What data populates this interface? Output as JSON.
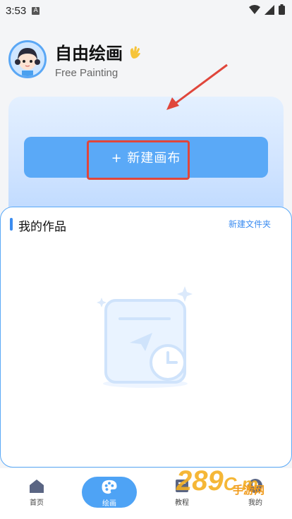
{
  "status_bar": {
    "time": "3:53",
    "a_badge": "A"
  },
  "header": {
    "title": "自由绘画",
    "subtitle": "Free Painting"
  },
  "hero": {
    "new_canvas_label": "+ 新建画布"
  },
  "works": {
    "title": "我的作品",
    "new_folder_label": "新建文件夹"
  },
  "bottom_nav": [
    {
      "label": "首页",
      "icon": "home-icon"
    },
    {
      "label": "绘画",
      "icon": "palette-icon"
    },
    {
      "label": "教程",
      "icon": "book-icon"
    },
    {
      "label": "我的",
      "icon": "user-icon"
    }
  ],
  "watermark": {
    "main": "289",
    "tail": "C m",
    "sub": "手游网"
  },
  "colors": {
    "accent": "#5aa9f7",
    "annotation": "#e0463b"
  }
}
